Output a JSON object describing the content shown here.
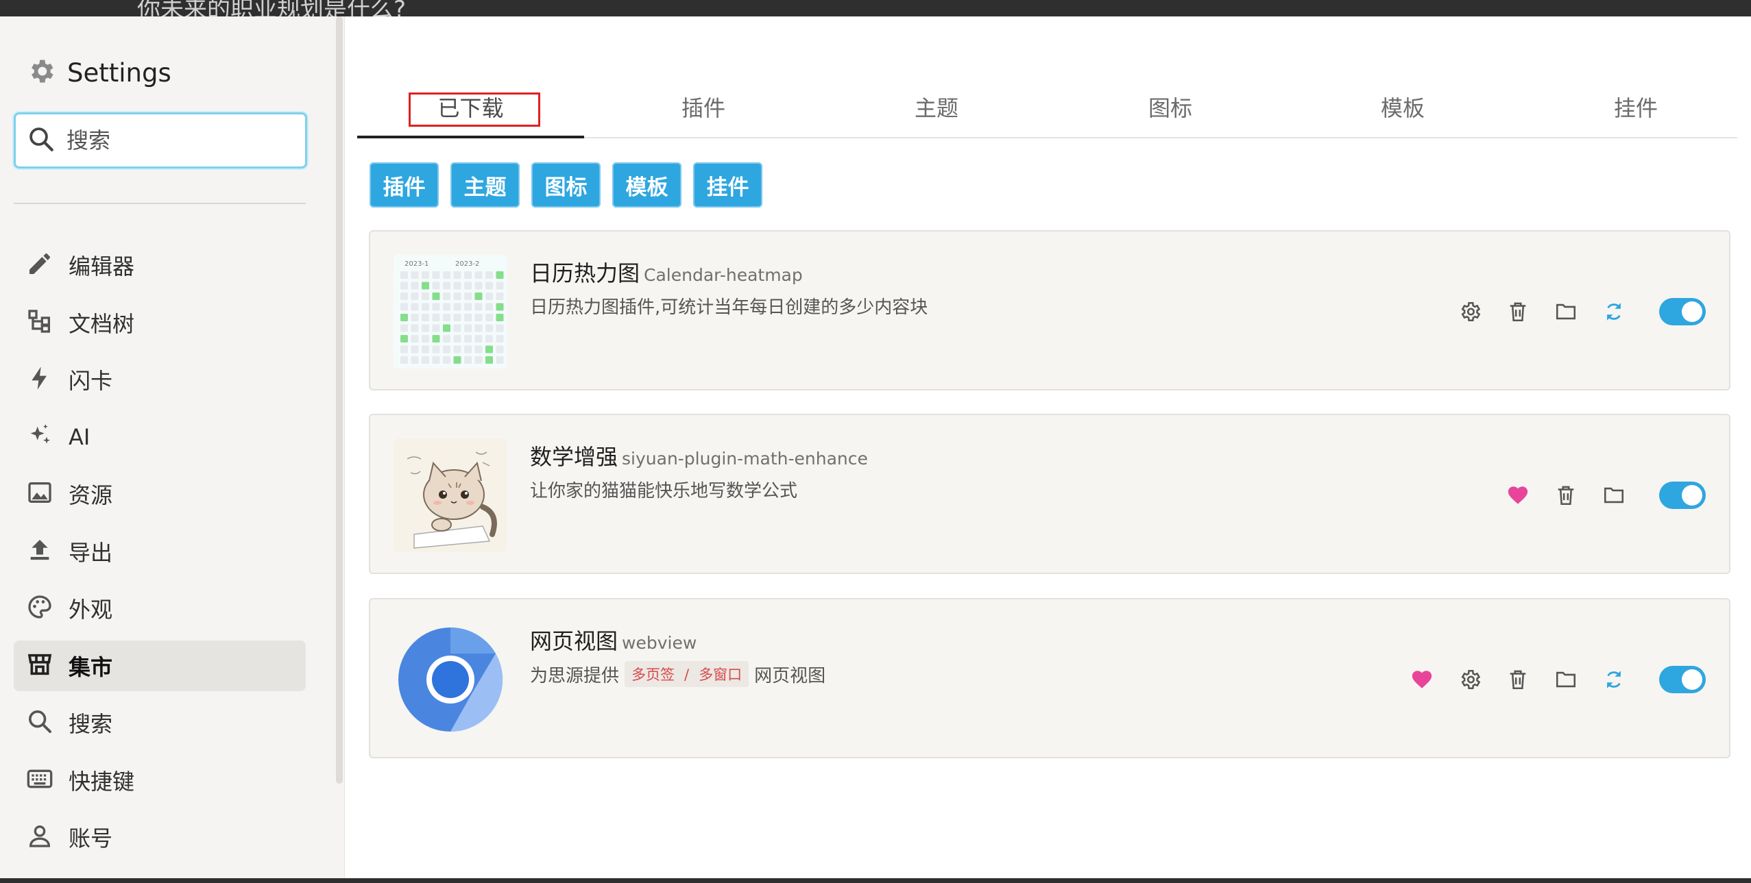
{
  "topbar": {
    "text": "你未来的职业规划是什么?"
  },
  "sidebar": {
    "title": "Settings",
    "search_placeholder": "搜索",
    "items": [
      {
        "label": "编辑器",
        "icon": "pencil-icon",
        "active": false
      },
      {
        "label": "文档树",
        "icon": "tree-icon",
        "active": false
      },
      {
        "label": "闪卡",
        "icon": "lightning-icon",
        "active": false
      },
      {
        "label": "AI",
        "icon": "sparkle-icon",
        "active": false
      },
      {
        "label": "资源",
        "icon": "image-icon",
        "active": false
      },
      {
        "label": "导出",
        "icon": "upload-icon",
        "active": false
      },
      {
        "label": "外观",
        "icon": "palette-icon",
        "active": false
      },
      {
        "label": "集市",
        "icon": "store-icon",
        "active": true
      },
      {
        "label": "搜索",
        "icon": "search-icon",
        "active": false
      },
      {
        "label": "快捷键",
        "icon": "keyboard-icon",
        "active": false
      },
      {
        "label": "账号",
        "icon": "user-icon",
        "active": false
      }
    ]
  },
  "tabs": [
    {
      "label": "已下载",
      "active": true
    },
    {
      "label": "插件",
      "active": false
    },
    {
      "label": "主题",
      "active": false
    },
    {
      "label": "图标",
      "active": false
    },
    {
      "label": "模板",
      "active": false
    },
    {
      "label": "挂件",
      "active": false
    }
  ],
  "filters": [
    "插件",
    "主题",
    "图标",
    "模板",
    "挂件"
  ],
  "heatmap_labels": [
    "2023-1",
    "2023-2"
  ],
  "cards": [
    {
      "name": "日历热力图",
      "id": "Calendar-heatmap",
      "desc": "日历热力图插件,可统计当年每日创建的多少内容块",
      "actions": [
        "gear-icon",
        "trash-icon",
        "folder-icon",
        "refresh-icon"
      ],
      "enabled": true
    },
    {
      "name": "数学增强",
      "id": "siyuan-plugin-math-enhance",
      "desc": "让你家的猫猫能快乐地写数学公式",
      "actions": [
        "heart-icon",
        "trash-icon",
        "folder-icon"
      ],
      "enabled": true
    },
    {
      "name": "网页视图",
      "id": "webview",
      "desc_before": "为思源提供",
      "tag1": "多页签",
      "tag_sep": "/",
      "tag2": "多窗口",
      "desc_after": "网页视图",
      "actions": [
        "heart-icon",
        "gear-icon",
        "trash-icon",
        "folder-icon",
        "refresh-icon"
      ],
      "enabled": true
    }
  ],
  "colors": {
    "accent": "#2ea6e0",
    "heart": "#e8459a",
    "refresh": "#2ea6e0",
    "annotation": "#e02020"
  }
}
